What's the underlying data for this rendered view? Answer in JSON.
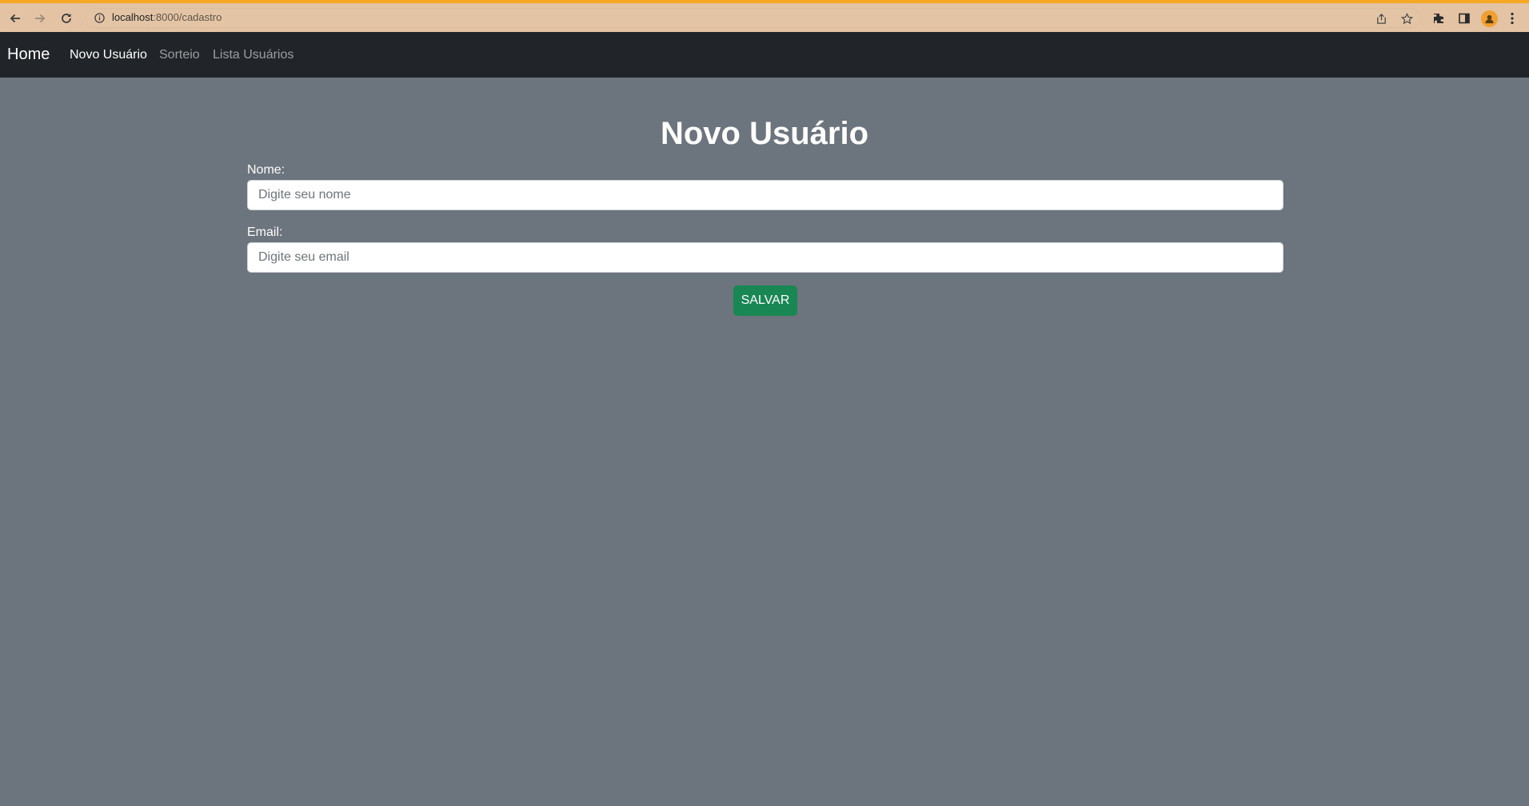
{
  "browser": {
    "url_host": "localhost",
    "url_path": ":8000/cadastro"
  },
  "navbar": {
    "brand": "Home",
    "links": [
      {
        "label": "Novo Usuário",
        "active": true
      },
      {
        "label": "Sorteio",
        "active": false
      },
      {
        "label": "Lista Usuários",
        "active": false
      }
    ]
  },
  "form": {
    "title": "Novo Usuário",
    "name_label": "Nome:",
    "name_placeholder": "Digite seu nome",
    "name_value": "",
    "email_label": "Email:",
    "email_placeholder": "Digite seu email",
    "email_value": "",
    "submit_label": "SALVAR"
  },
  "colors": {
    "page_background": "#6c757d",
    "navbar_background": "#212529",
    "submit_button": "#198754",
    "browser_frame": "#e3c3a3"
  }
}
